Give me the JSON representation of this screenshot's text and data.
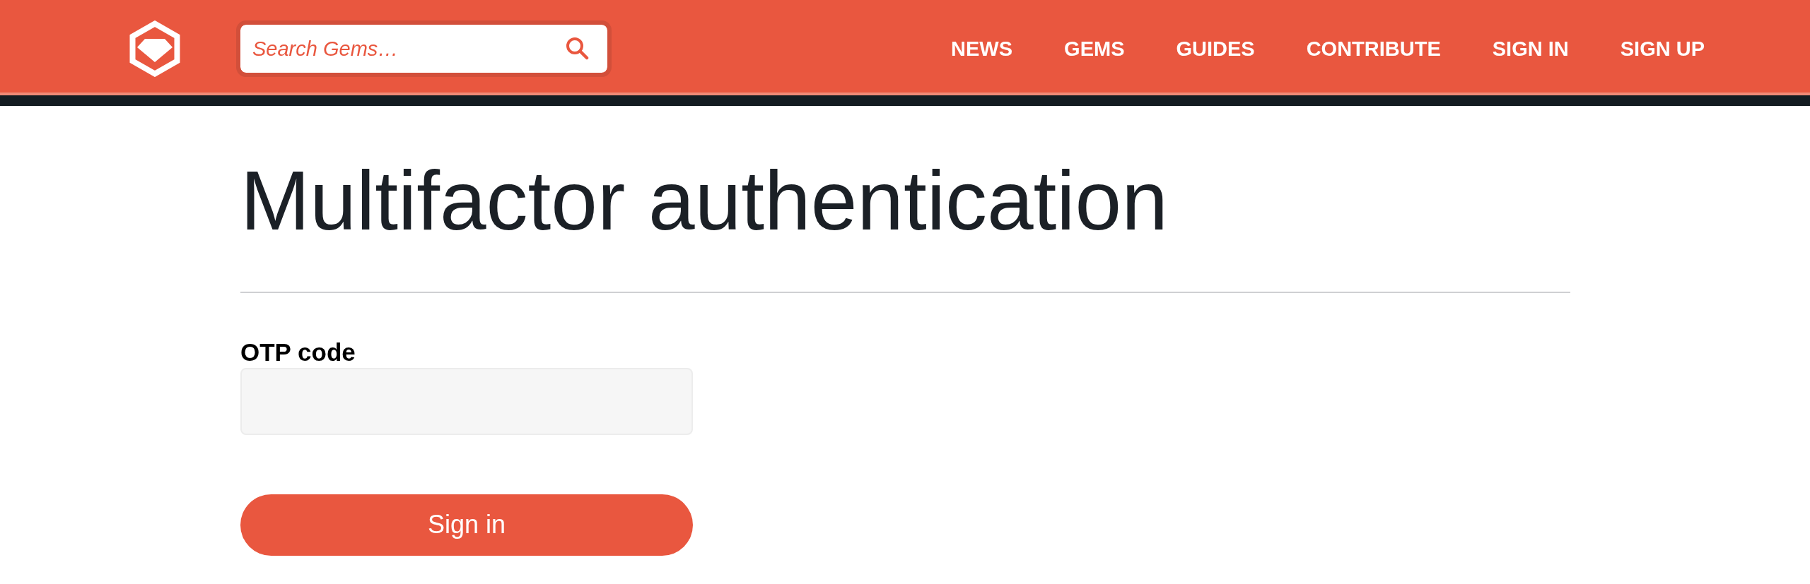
{
  "header": {
    "search": {
      "placeholder": "Search Gems…"
    },
    "nav": [
      {
        "label": "NEWS"
      },
      {
        "label": "GEMS"
      },
      {
        "label": "GUIDES"
      },
      {
        "label": "CONTRIBUTE"
      },
      {
        "label": "SIGN IN"
      },
      {
        "label": "SIGN UP"
      }
    ]
  },
  "page": {
    "title": "Multifactor authentication"
  },
  "form": {
    "fields": [
      {
        "label": "OTP code"
      }
    ],
    "submit": "Sign in"
  }
}
